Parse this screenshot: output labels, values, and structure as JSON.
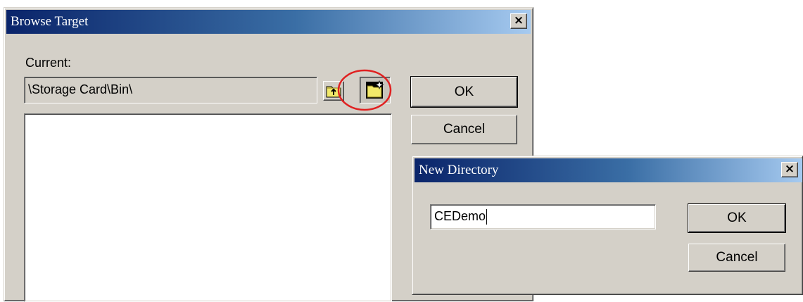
{
  "browse_dialog": {
    "title": "Browse Target",
    "close_glyph": "×",
    "current_label": "Current:",
    "current_path": "\\Storage Card\\Bin\\",
    "ok_label": "OK",
    "cancel_label": "Cancel",
    "up_folder_icon": "folder-up-icon",
    "new_folder_icon": "new-folder-icon"
  },
  "new_directory_dialog": {
    "title": "New Directory",
    "close_glyph": "×",
    "name_value": "CEDemo",
    "ok_label": "OK",
    "cancel_label": "Cancel"
  },
  "annotation": {
    "highlight_color": "#e02020",
    "target": "new-folder-button"
  },
  "colors": {
    "titlebar_start": "#0a246a",
    "titlebar_end": "#a6caf0",
    "dialog_face": "#d4d0c8"
  }
}
